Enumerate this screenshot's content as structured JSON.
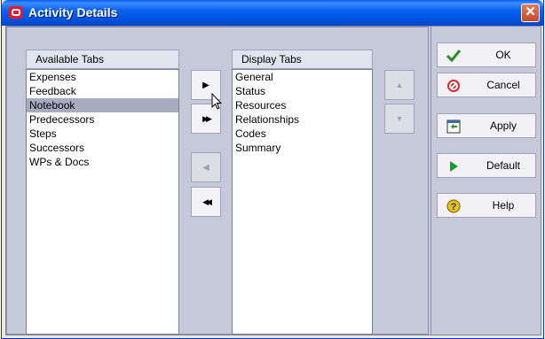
{
  "window": {
    "title": "Activity Details",
    "close_glyph": "✕"
  },
  "available": {
    "header": "Available Tabs",
    "items": [
      "Expenses",
      "Feedback",
      "Notebook",
      "Predecessors",
      "Steps",
      "Successors",
      "WPs & Docs"
    ],
    "selected": "Notebook"
  },
  "display": {
    "header": "Display Tabs",
    "items": [
      "General",
      "Status",
      "Resources",
      "Relationships",
      "Codes",
      "Summary"
    ]
  },
  "transfer": {
    "move_right": "▶",
    "move_all_right": "▶▶",
    "move_left": "◀",
    "move_all_left": "◀◀",
    "move_up": "▲",
    "move_down": "▼"
  },
  "buttons": {
    "ok": {
      "label": "OK",
      "icon": "check-icon",
      "icon_color": "#2e8b22"
    },
    "cancel": {
      "label": "Cancel",
      "icon": "cancel-icon",
      "icon_color": "#e0262e"
    },
    "apply": {
      "label": "Apply",
      "icon": "apply-icon",
      "icon_color": "#2e8b22"
    },
    "default": {
      "label": "Default",
      "icon": "play-icon",
      "icon_color": "#1a9c2a"
    },
    "help": {
      "label": "Help",
      "icon": "help-icon",
      "icon_color": "#e8c400"
    }
  }
}
